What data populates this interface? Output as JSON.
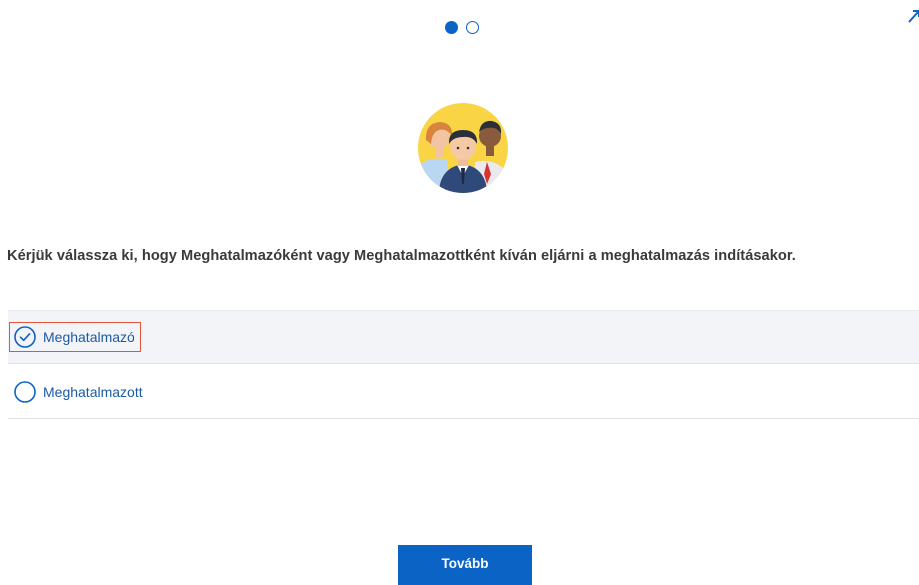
{
  "stepper": {
    "current_step": 1,
    "total_steps": 2
  },
  "header": {
    "corner_icon": "expand-arrow-icon"
  },
  "illustration": {
    "icon": "people-group-icon"
  },
  "question": "Kérjük válassza ki, hogy Meghatalmazóként vagy Meghatalmazottként kíván eljárni a meghatalmazás indításakor.",
  "options": [
    {
      "label": "Meghatalmazó",
      "selected": true
    },
    {
      "label": "Meghatalmazott",
      "selected": false
    }
  ],
  "next_button": {
    "label": "Tovább"
  },
  "colors": {
    "accent": "#0b63c5",
    "focus": "#e5543a",
    "option_label": "#1c5aa6"
  }
}
